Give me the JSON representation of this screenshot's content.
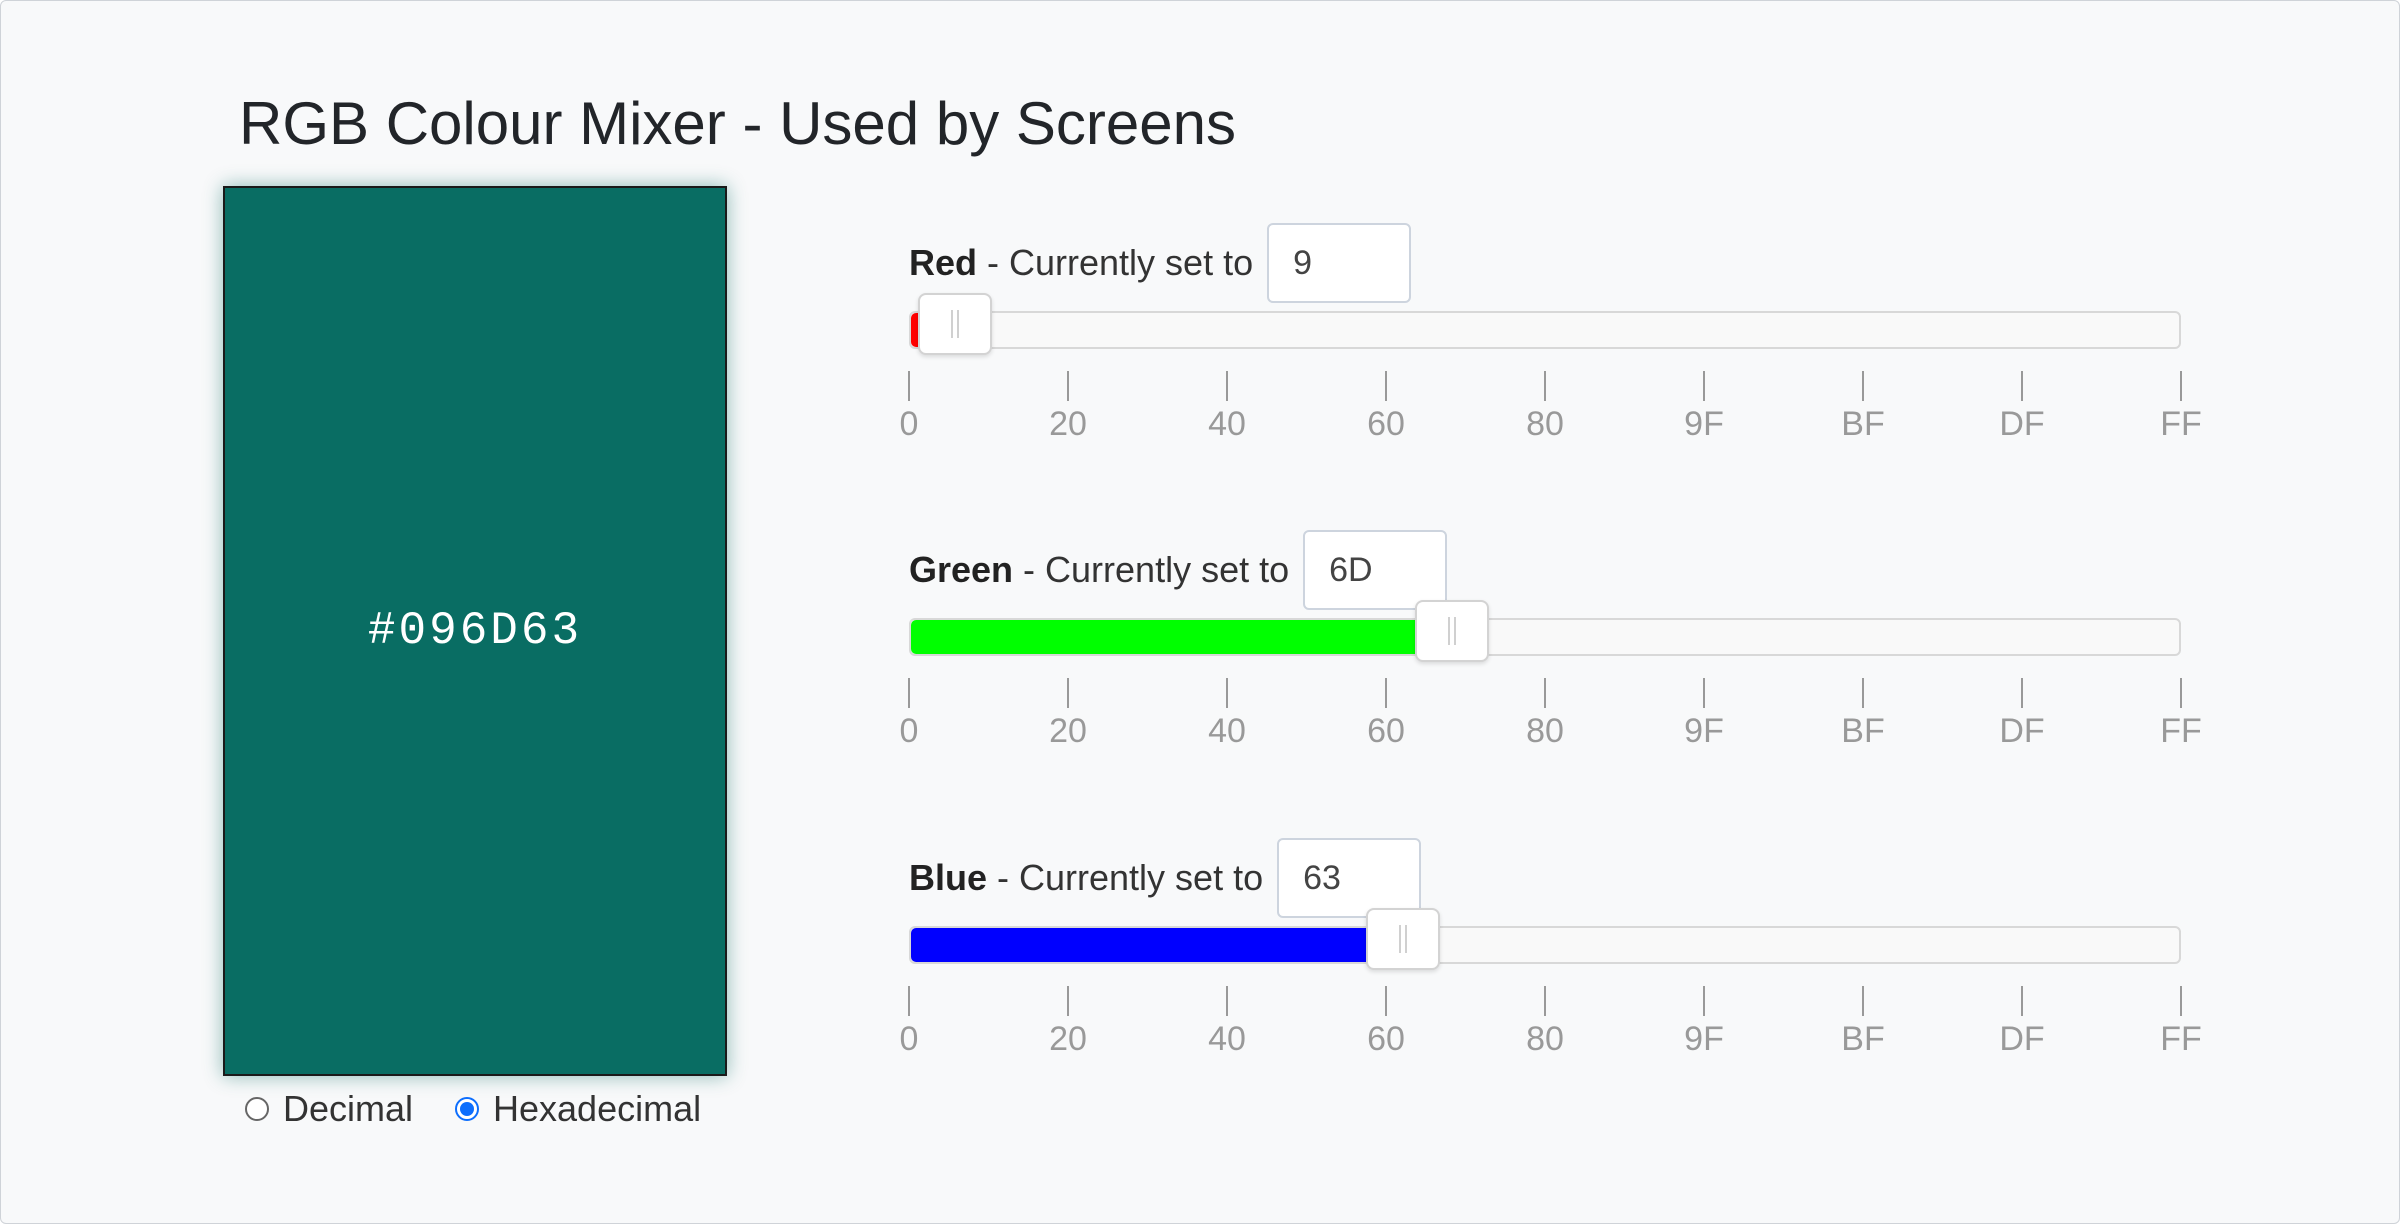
{
  "title": "RGB Colour Mixer - Used by Screens",
  "swatch": {
    "hex": "#096D63",
    "color": "#096D63"
  },
  "mode": {
    "options": [
      {
        "label": "Decimal",
        "selected": false
      },
      {
        "label": "Hexadecimal",
        "selected": true
      }
    ]
  },
  "tick_labels": [
    "0",
    "20",
    "40",
    "60",
    "80",
    "9F",
    "BF",
    "DF",
    "FF"
  ],
  "channels": [
    {
      "name": "Red",
      "suffix": "- Currently set to",
      "value": "9",
      "level": 0.035,
      "color": "#ff0000"
    },
    {
      "name": "Green",
      "suffix": "- Currently set to",
      "value": "6D",
      "level": 0.427,
      "color": "#00ff00"
    },
    {
      "name": "Blue",
      "suffix": "- Currently set to",
      "value": "63",
      "level": 0.388,
      "color": "#0000ff"
    }
  ]
}
